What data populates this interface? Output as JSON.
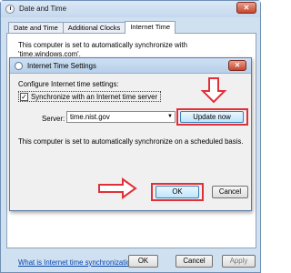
{
  "outer": {
    "title": "Date and Time",
    "close_glyph": "✕",
    "tabs": [
      {
        "label": "Date and Time"
      },
      {
        "label": "Additional Clocks"
      },
      {
        "label": "Internet Time"
      }
    ],
    "sync_text": "This computer is set to automatically synchronize with 'time.windows.com'.",
    "link_text": "What is Internet time synchronization?",
    "ok_label": "OK",
    "cancel_label": "Cancel",
    "apply_label": "Apply"
  },
  "inner": {
    "title": "Internet Time Settings",
    "close_glyph": "✕",
    "configure_label": "Configure Internet time settings:",
    "sync_checkbox_label": "Synchronize with an Internet time server",
    "sync_checked": true,
    "server_label": "Server:",
    "server_value": "time.nist.gov",
    "update_label": "Update now",
    "auto_text": "This computer is set to automatically synchronize on a scheduled basis.",
    "ok_label": "OK",
    "cancel_label": "Cancel"
  },
  "annotations": {
    "highlight_color": "#e0303a"
  }
}
